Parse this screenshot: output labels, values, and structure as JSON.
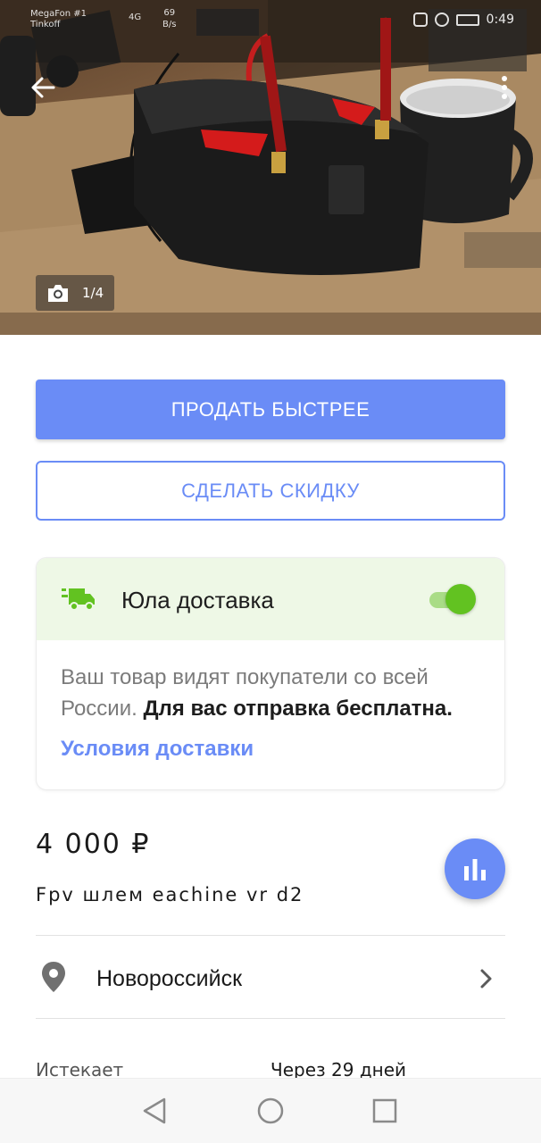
{
  "status_bar": {
    "carrier1": "MegaFon #1",
    "carrier2": "Tinkoff",
    "network": "4G",
    "speed_value": "69",
    "speed_unit": "B/s",
    "time": "0:49"
  },
  "gallery": {
    "counter": "1/4"
  },
  "actions": {
    "sell_faster": "ПРОДАТЬ БЫСТРЕЕ",
    "make_discount": "СДЕЛАТЬ СКИДКУ"
  },
  "delivery": {
    "title": "Юла доставка",
    "enabled": true,
    "description": "Ваш товар видят покупатели со всей России.",
    "description_bold": "Для вас отправка бесплатна.",
    "link": "Условия доставки"
  },
  "listing": {
    "price": "4 000 ₽",
    "title": "Fpv шлем eachine vr d2",
    "location": "Новороссийск",
    "expires_label": "Истекает",
    "expires_value": "Через 29 дней"
  },
  "colors": {
    "accent": "#6a8cf6",
    "delivery_green": "#62c221",
    "delivery_bg": "#eef8e6"
  },
  "icons": {
    "back": "arrow-left",
    "more": "vertical-dots",
    "camera": "camera",
    "truck": "delivery-truck",
    "stats": "bar-chart",
    "location": "map-pin",
    "chevron": "chevron-right",
    "nav_back": "triangle-back",
    "nav_home": "circle-home",
    "nav_recent": "square-recent"
  }
}
